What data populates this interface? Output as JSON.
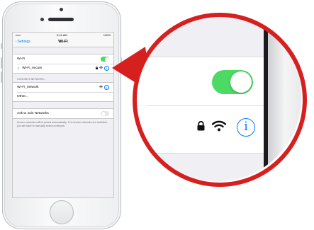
{
  "status_bar": {
    "carrier": "•••••",
    "time": "9:41 AM",
    "battery": "100%"
  },
  "nav": {
    "back_label": "Settings",
    "title": "Wi-Fi"
  },
  "wifi_row": {
    "label": "Wi-Fi",
    "enabled": true
  },
  "connected_network": {
    "check": "✓",
    "name": "Wi-Fi_secure",
    "lock": "🔒",
    "signal": "📶"
  },
  "choose_section": {
    "header": "CHOOSE A NETWORK...",
    "networks": [
      {
        "name": "Wi-Fi_network"
      },
      {
        "name": "Other..."
      }
    ]
  },
  "ask_row": {
    "label": "Ask to Join Networks",
    "enabled": false,
    "footer": "Known networks will be joined automatically. If no known networks are available, you will have to manually select a network."
  },
  "callout": {
    "info_glyph": "i",
    "accent_color": "#d6201f",
    "toggle_color": "#4cd964",
    "info_color": "#007aff"
  }
}
